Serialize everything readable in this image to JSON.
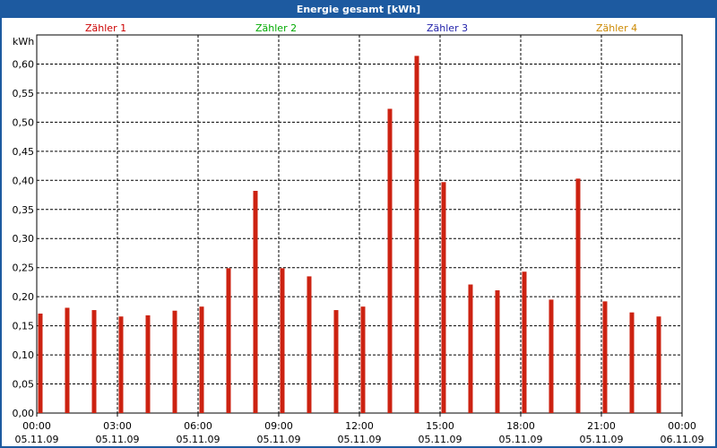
{
  "window": {
    "title": "Energie gesamt [kWh]"
  },
  "legend": [
    {
      "label": "Zähler 1",
      "color": "#cc0000"
    },
    {
      "label": "Zähler 2",
      "color": "#00aa00"
    },
    {
      "label": "Zähler 3",
      "color": "#2222aa"
    },
    {
      "label": "Zähler 4",
      "color": "#cc8800"
    }
  ],
  "chart_data": {
    "type": "bar",
    "title": "Energie gesamt [kWh]",
    "ylabel": "kWh",
    "ylim": [
      0,
      0.65
    ],
    "yticks": [
      "0,00",
      "0,05",
      "0,10",
      "0,15",
      "0,20",
      "0,25",
      "0,30",
      "0,35",
      "0,40",
      "0,45",
      "0,50",
      "0,55",
      "0,60"
    ],
    "xticks": [
      {
        "time": "00:00",
        "date": "05.11.09"
      },
      {
        "time": "03:00",
        "date": "05.11.09"
      },
      {
        "time": "06:00",
        "date": "05.11.09"
      },
      {
        "time": "09:00",
        "date": "05.11.09"
      },
      {
        "time": "12:00",
        "date": "05.11.09"
      },
      {
        "time": "15:00",
        "date": "05.11.09"
      },
      {
        "time": "18:00",
        "date": "05.11.09"
      },
      {
        "time": "21:00",
        "date": "05.11.09"
      },
      {
        "time": "00:00",
        "date": "06.11.09"
      }
    ],
    "grid": true,
    "bar_color": "#cc2211",
    "series": [
      {
        "name": "Zähler 1",
        "categories": [
          "00:00",
          "01:00",
          "02:00",
          "03:00",
          "04:00",
          "05:00",
          "06:00",
          "07:00",
          "08:00",
          "09:00",
          "10:00",
          "11:00",
          "12:00",
          "13:00",
          "14:00",
          "15:00",
          "16:00",
          "17:00",
          "18:00",
          "19:00",
          "20:00",
          "21:00",
          "22:00",
          "23:00"
        ],
        "values": [
          0.171,
          0.181,
          0.177,
          0.166,
          0.168,
          0.176,
          0.183,
          0.249,
          0.382,
          0.249,
          0.235,
          0.177,
          0.183,
          0.523,
          0.614,
          0.397,
          0.221,
          0.211,
          0.243,
          0.195,
          0.403,
          0.192,
          0.173,
          0.166
        ]
      }
    ]
  }
}
